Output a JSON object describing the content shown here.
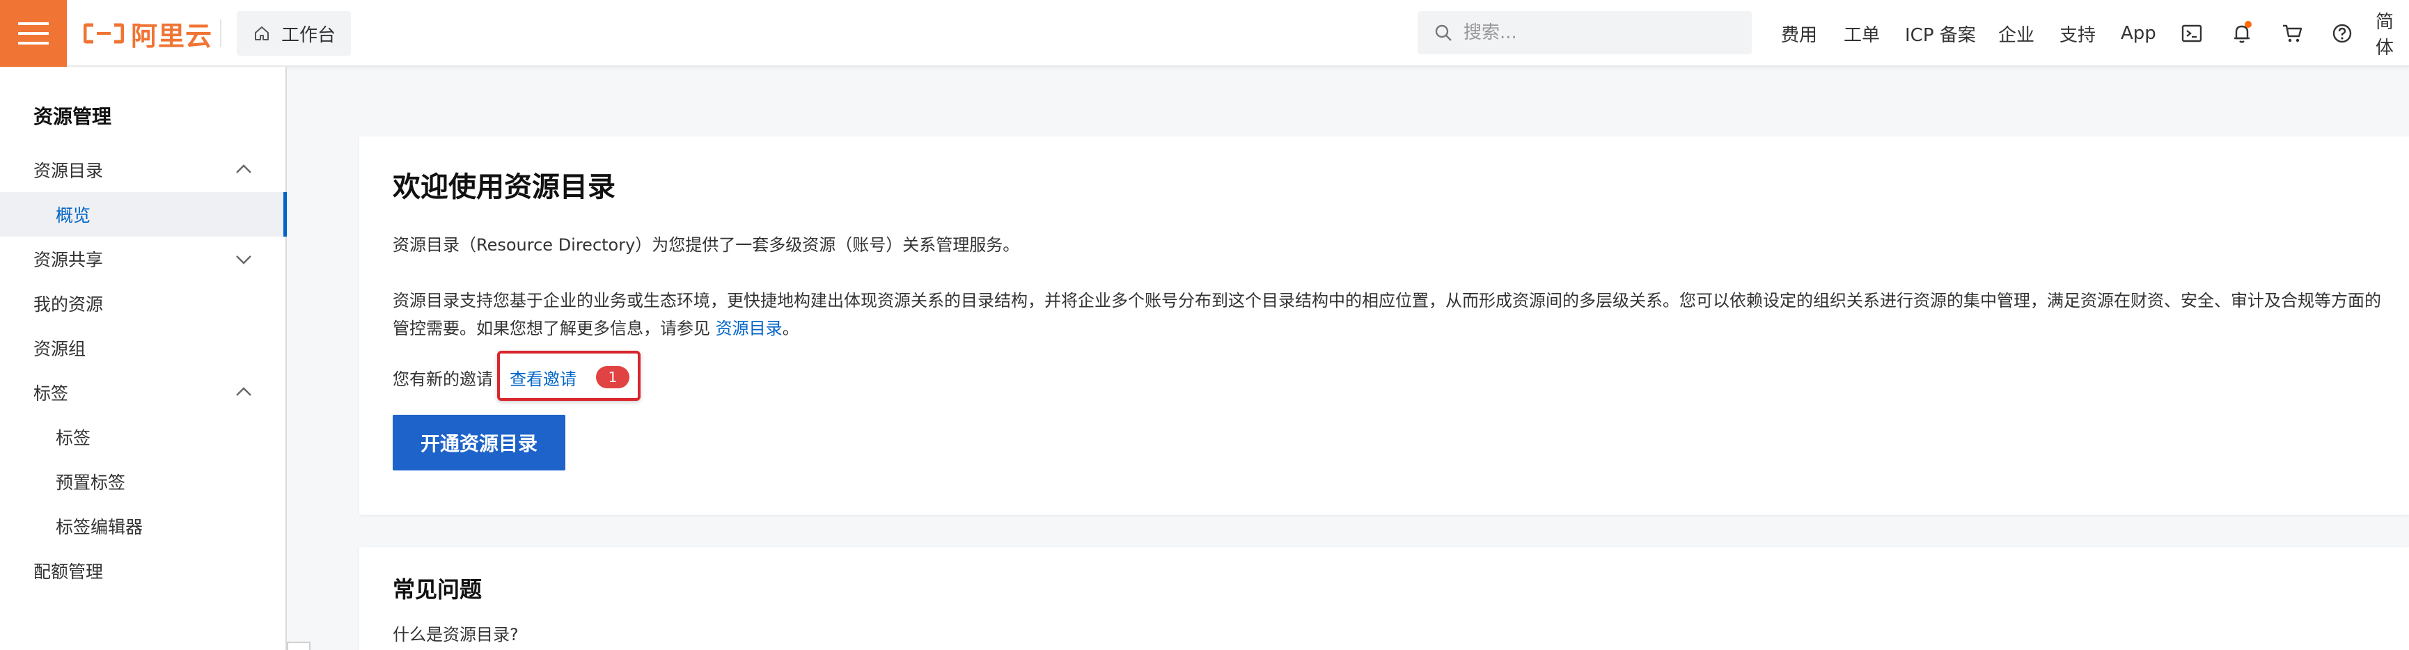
{
  "topbar": {
    "logo_text": "阿里云",
    "workbench_label": "工作台",
    "search_placeholder": "搜索...",
    "nav": [
      "费用",
      "工单",
      "ICP 备案",
      "企业",
      "支持",
      "App"
    ],
    "lang_label": "简体",
    "icons": [
      "terminal-icon",
      "bell-icon",
      "cart-icon",
      "help-icon"
    ],
    "brand_color": "#f07434"
  },
  "sidebar": {
    "title": "资源管理",
    "items": [
      {
        "label": "资源目录",
        "level": 1,
        "expandable": true,
        "expanded": true
      },
      {
        "label": "概览",
        "level": 2,
        "active": true
      },
      {
        "label": "资源共享",
        "level": 1,
        "expandable": true,
        "expanded": false
      },
      {
        "label": "我的资源",
        "level": 1
      },
      {
        "label": "资源组",
        "level": 1
      },
      {
        "label": "标签",
        "level": 1,
        "expandable": true,
        "expanded": true
      },
      {
        "label": "标签",
        "level": 2
      },
      {
        "label": "预置标签",
        "level": 2
      },
      {
        "label": "标签编辑器",
        "level": 2
      },
      {
        "label": "配额管理",
        "level": 1
      }
    ],
    "accent_color": "#0064c8"
  },
  "main": {
    "welcome": {
      "title": "欢迎使用资源目录",
      "intro": "资源目录（Resource Directory）为您提供了一套多级资源（账号）关系管理服务。",
      "desc_line1": "资源目录支持您基于企业的业务或生态环境，更快捷地构建出体现资源关系的目录结构，并将企业多个账号分布到这个目录结构中的相应位置，从而形成资源间的多层级关系。您可以依赖设定的组织关系进行资源的集中管理，满足资源在财资、安全、审计及合规等方面的",
      "desc_line2_prefix": "管控需要。如果您想了解更多信息，请参见 ",
      "desc_link": "资源目录",
      "desc_line2_suffix": "。",
      "invite_text": "您有新的邀请",
      "invite_link": "查看邀请",
      "invite_count": "1",
      "primary_button": "开通资源目录"
    },
    "faq": {
      "title": "常见问题",
      "first_question": "什么是资源目录?"
    }
  }
}
